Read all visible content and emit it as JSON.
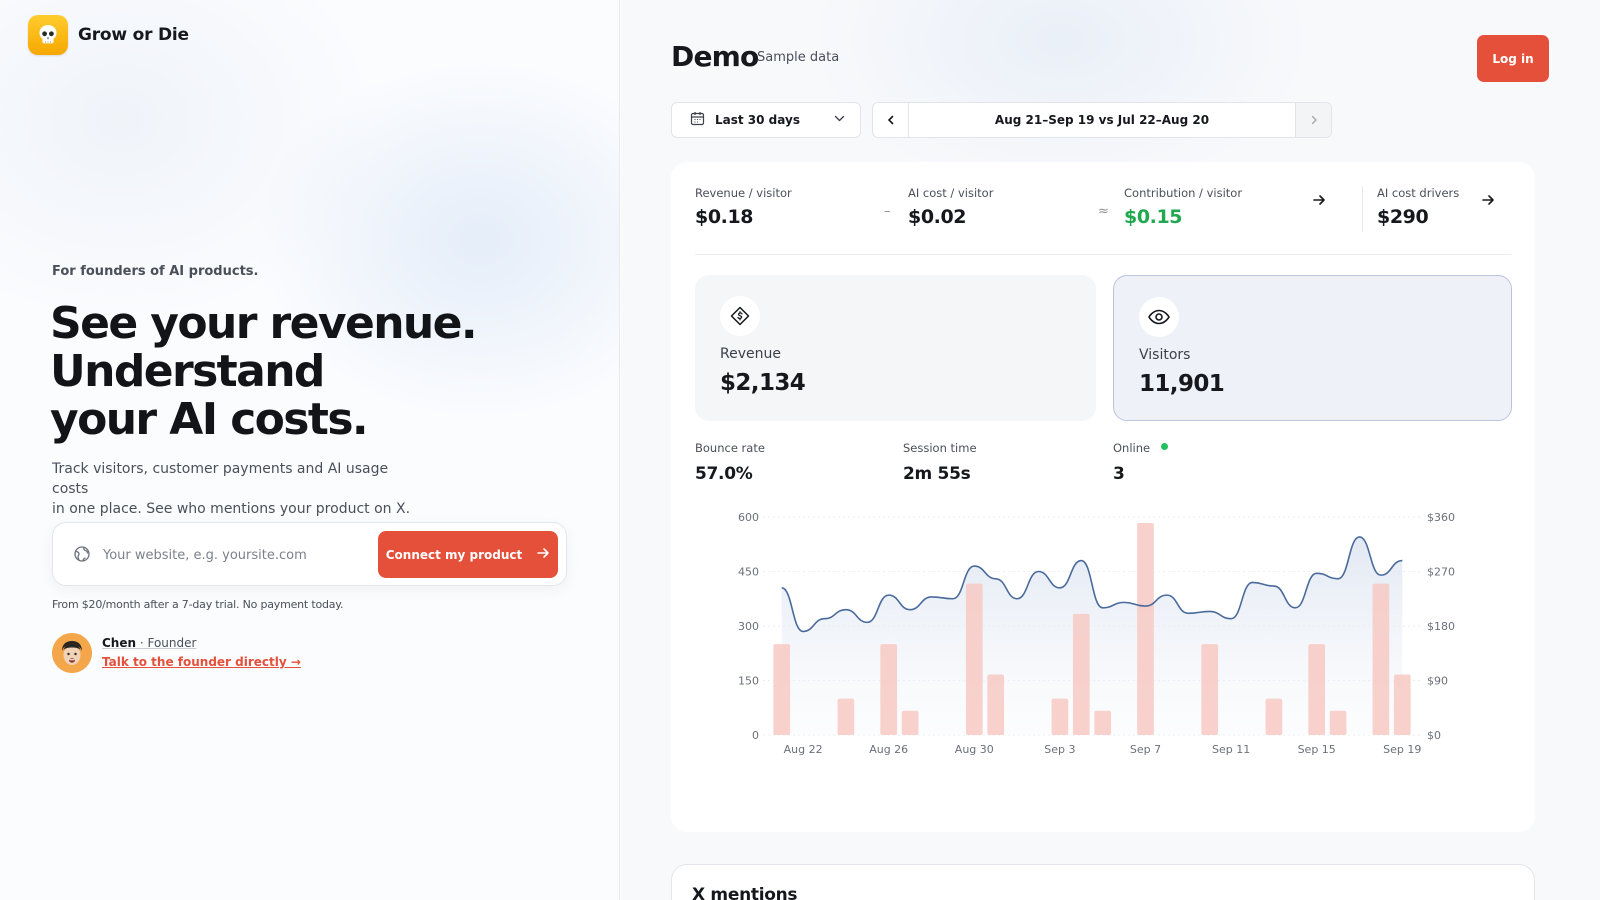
{
  "brand": {
    "name": "Grow or Die"
  },
  "hero": {
    "eyebrow": "For founders of AI products.",
    "headline": [
      "See your revenue.",
      "Understand",
      "your AI costs."
    ],
    "subcopy": [
      "Track visitors, customer payments and AI usage costs",
      "in one place. See who mentions your product on X."
    ],
    "input_placeholder": "Your website, e.g. yoursite.com",
    "input_value": "",
    "cta_label": "Connect my product",
    "pricing_note": "From $20/month after a 7-day trial. No payment today.",
    "founder": {
      "name": "Chen",
      "role": "· Founder",
      "link": "Talk to the founder directly →"
    }
  },
  "demo": {
    "title": "Demo",
    "subtitle": "Sample data",
    "login_label": "Log in",
    "range_label": "Last 30 days",
    "period_label": "Aug 21–Sep 19 vs Jul 22–Aug 20",
    "metrics": [
      {
        "label": "Revenue / visitor",
        "value": "$0.18"
      },
      {
        "label": "AI cost / visitor",
        "value": "$0.02"
      },
      {
        "label": "Contribution / visitor",
        "value": "$0.15"
      },
      {
        "label": "AI cost drivers",
        "value": "$290"
      }
    ],
    "operators": {
      "minus": "–",
      "approx": "≈"
    },
    "tiles": [
      {
        "label": "Revenue",
        "value": "$2,134",
        "icon": "ticket-dollar-icon"
      },
      {
        "label": "Visitors",
        "value": "11,901",
        "icon": "eye-icon",
        "selected": true
      }
    ],
    "stats": [
      {
        "label": "Bounce rate",
        "value": "57.0%"
      },
      {
        "label": "Session time",
        "value": "2m 55s"
      },
      {
        "label": "Online",
        "value": "3"
      }
    ],
    "x_mentions_title": "X mentions"
  },
  "colors": {
    "accent": "#e5503b",
    "positive": "#1fa84f",
    "line": "#4a6a9c",
    "bar": "#f7c9c3",
    "online": "#22c05a"
  },
  "chart_data": {
    "type": "bar+line",
    "x_tick_labels": [
      "Aug 22",
      "Aug 26",
      "Aug 30",
      "Sep 3",
      "Sep 7",
      "Sep 11",
      "Sep 15",
      "Sep 19"
    ],
    "y_left": {
      "ticks": [
        0,
        150,
        300,
        450,
        600
      ],
      "lim": [
        0,
        600
      ]
    },
    "y_right": {
      "ticks": [
        "$0",
        "$90",
        "$180",
        "$270",
        "$360"
      ],
      "lim": [
        0,
        360
      ]
    },
    "days": [
      "Aug 21",
      "Aug 22",
      "Aug 23",
      "Aug 24",
      "Aug 25",
      "Aug 26",
      "Aug 27",
      "Aug 28",
      "Aug 29",
      "Aug 30",
      "Aug 31",
      "Sep 1",
      "Sep 2",
      "Sep 3",
      "Sep 4",
      "Sep 5",
      "Sep 6",
      "Sep 7",
      "Sep 8",
      "Sep 9",
      "Sep 10",
      "Sep 11",
      "Sep 12",
      "Sep 13",
      "Sep 14",
      "Sep 15",
      "Sep 16",
      "Sep 17",
      "Sep 18",
      "Sep 19"
    ],
    "visitors": [
      405,
      285,
      320,
      345,
      310,
      385,
      345,
      380,
      375,
      465,
      430,
      375,
      450,
      405,
      480,
      350,
      365,
      355,
      385,
      335,
      340,
      320,
      420,
      410,
      350,
      445,
      430,
      545,
      440,
      480
    ],
    "revenue": [
      150,
      0,
      0,
      60,
      0,
      150,
      40,
      0,
      0,
      250,
      100,
      0,
      0,
      60,
      200,
      40,
      0,
      350,
      0,
      0,
      150,
      0,
      0,
      60,
      0,
      150,
      40,
      0,
      250,
      100
    ],
    "grid": true
  }
}
